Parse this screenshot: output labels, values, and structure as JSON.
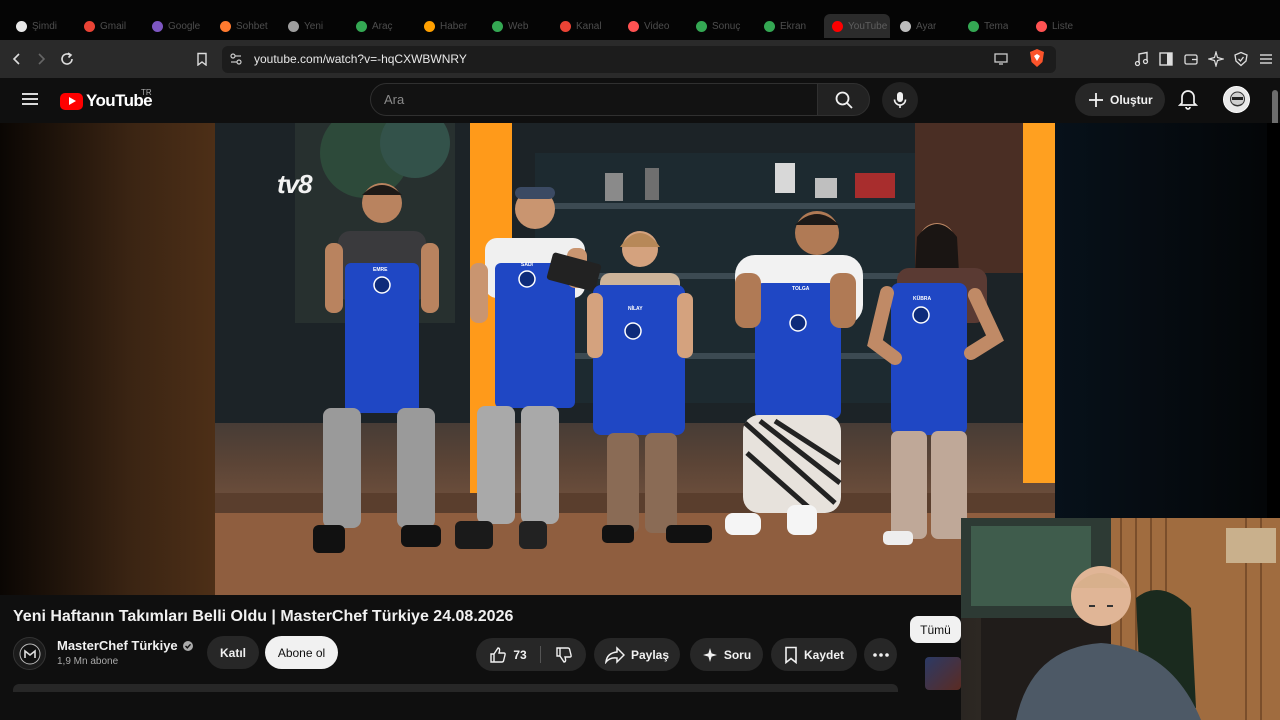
{
  "browser": {
    "tabs": [
      {
        "label": "Şimdi",
        "color": "#e8e8e8"
      },
      {
        "label": "Gmail",
        "color": "#ea4335"
      },
      {
        "label": "Google",
        "color": "#7e57c2"
      },
      {
        "label": "Sohbet",
        "color": "#ff7a2f"
      },
      {
        "label": "Yeni",
        "color": "#9e9e9e"
      },
      {
        "label": "Araç",
        "color": "#34a853"
      },
      {
        "label": "Haber",
        "color": "#ffa000"
      },
      {
        "label": "Web",
        "color": "#34a853"
      },
      {
        "label": "Kanal",
        "color": "#ea4335"
      },
      {
        "label": "Video",
        "color": "#ff5252"
      },
      {
        "label": "Sonuç",
        "color": "#34a853"
      },
      {
        "label": "Ekran",
        "color": "#34a853"
      },
      {
        "label": "YouTube",
        "color": "#ff0000"
      },
      {
        "label": "Ayar",
        "color": "#bdbdbd"
      },
      {
        "label": "Tema",
        "color": "#34a853"
      },
      {
        "label": "Liste",
        "color": "#ff5252"
      }
    ],
    "url": "youtube.com/watch?v=-hqCXWBWNRY"
  },
  "header": {
    "logo_text": "YouTube",
    "region": "TR",
    "search_placeholder": "Ara",
    "create_label": "Oluştur"
  },
  "video": {
    "channel_logo_text": "tv8",
    "apron_names": [
      "EMRE",
      "SADİ",
      "NİLAY",
      "TOLGA",
      "KÜBRA"
    ],
    "title": "Yeni Haftanın Takımları Belli Oldu | MasterChef Türkiye 24.08.2026",
    "channel_name": "MasterChef Türkiye",
    "subscribers": "1,9 Mn abone",
    "join_label": "Katıl",
    "subscribe_label": "Abone ol",
    "like_count": "73",
    "share_label": "Paylaş",
    "ask_label": "Soru",
    "save_label": "Kaydet"
  },
  "sidebar": {
    "chip_all": "Tümü"
  },
  "colors": {
    "accent": "#ff0000",
    "apron": "#1f47c4",
    "stage_orange": "#ff9a1a"
  }
}
